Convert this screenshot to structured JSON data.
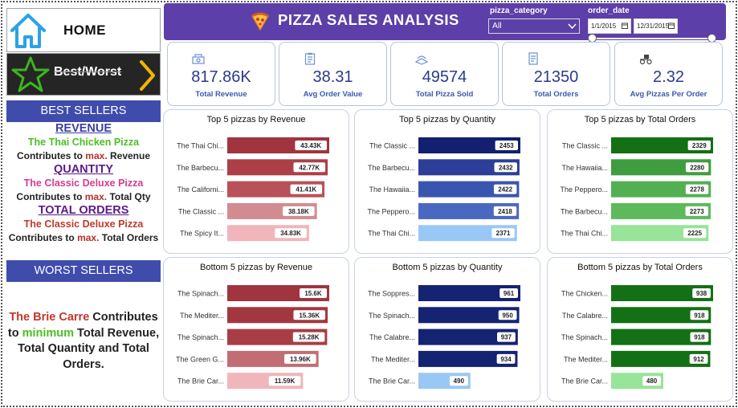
{
  "home": {
    "label": "HOME",
    "icon": "home-icon"
  },
  "nav": {
    "label": "Best/Worst",
    "icons": [
      "star-icon",
      "chevron-right-icon"
    ]
  },
  "best": {
    "heading": "BEST SELLERS",
    "revenue_hdr": "REVENUE",
    "revenue_pizza": "The Thai Chicken Pizza",
    "revenue_pre": "Contributes to ",
    "revenue_max": "max.",
    "revenue_post": " Revenue",
    "qty_hdr": "QUANTITY",
    "qty_pizza": "The Classic Deluxe Pizza",
    "qty_pre": "Contributes to ",
    "qty_max": "max.",
    "qty_post": " Total Qty",
    "orders_hdr": "TOTAL ORDERS",
    "orders_pizza": "The Classic Deluxe Pizza",
    "orders_pre": "Contributes to ",
    "orders_max": "max.",
    "orders_post": " Total Orders"
  },
  "worst": {
    "heading": "WORST SELLERS",
    "pizza": "The Brie Carre",
    "t1": " Contributes to ",
    "min": "minimum",
    "t2": " Total Revenue, Total Quantity and Total Orders."
  },
  "header": {
    "title": "PIZZA SALES ANALYSIS",
    "icon": "pizza-icon",
    "category_label": "pizza_category",
    "category_value": "All",
    "date_label": "order_date",
    "date_start": "1/1/2015",
    "date_end": "12/31/2015",
    "slider_start": 0,
    "slider_end": 1
  },
  "kpis": [
    {
      "value": "817.86K",
      "label": "Total Revenue",
      "icon": "money-icon"
    },
    {
      "value": "38.31",
      "label": "Avg Order Value",
      "icon": "clipboard-icon"
    },
    {
      "value": "49574",
      "label": "Total Pizza Sold",
      "icon": "pizza-box-icon"
    },
    {
      "value": "21350",
      "label": "Total Orders",
      "icon": "order-icon"
    },
    {
      "value": "2.32",
      "label": "Avg Pizzas Per Order",
      "icon": "delivery-icon"
    }
  ],
  "colors": {
    "header": "#5c3fa8",
    "section": "#3f4cab",
    "kpi_value": "#2b3a8c",
    "revenue": [
      "#a0353f",
      "#ac3f47",
      "#b85158",
      "#d28c91",
      "#f0b6bb"
    ],
    "quantity": [
      "#12206f",
      "#2c3e98",
      "#3a55b0",
      "#4b68c0",
      "#9ac8f6"
    ],
    "orders": [
      "#147014",
      "#3f9d3f",
      "#52b052",
      "#5cba5c",
      "#98e498"
    ],
    "bottom_revenue": [
      "#a0353f",
      "#a3373f",
      "#a83d45",
      "#c26d74",
      "#f0b6bb"
    ],
    "bottom_quantity": [
      "#152373",
      "#152373",
      "#152373",
      "#152373",
      "#9ac8f6"
    ],
    "bottom_orders": [
      "#147014",
      "#147014",
      "#147014",
      "#147014",
      "#98e498"
    ]
  },
  "chart_data": [
    {
      "type": "bar",
      "title": "Top 5 pizzas by Revenue",
      "categories": [
        "The Thai Chi...",
        "The Barbecu...",
        "The Californi...",
        "The Classic ...",
        "The Spicy It..."
      ],
      "values": [
        43434,
        42768,
        41410,
        38180,
        34831
      ],
      "labels": [
        "43.43K",
        "42.77K",
        "41.41K",
        "38.18K",
        "34.83K"
      ]
    },
    {
      "type": "bar",
      "title": "Top 5 pizzas by Quantity",
      "categories": [
        "The Classic ...",
        "The Barbecu...",
        "The Hawaiia...",
        "The Peppero...",
        "The Thai Chi..."
      ],
      "values": [
        2453,
        2432,
        2422,
        2418,
        2371
      ],
      "labels": [
        "2453",
        "2432",
        "2422",
        "2418",
        "2371"
      ]
    },
    {
      "type": "bar",
      "title": "Top 5 pizzas by Total Orders",
      "categories": [
        "The Classic ...",
        "The Hawaiia...",
        "The Peppero...",
        "The Barbecu...",
        "The Thai Chi..."
      ],
      "values": [
        2329,
        2280,
        2278,
        2273,
        2225
      ],
      "labels": [
        "2329",
        "2280",
        "2278",
        "2273",
        "2225"
      ]
    },
    {
      "type": "bar",
      "title": "Bottom 5 pizzas by Revenue",
      "categories": [
        "The Spinach...",
        "The Mediter...",
        "The Spinach...",
        "The Green G...",
        "The Brie Car..."
      ],
      "values": [
        15600,
        15360,
        15280,
        13960,
        11590
      ],
      "labels": [
        "15.6K",
        "15.36K",
        "15.28K",
        "13.96K",
        "11.59K"
      ]
    },
    {
      "type": "bar",
      "title": "Bottom 5 pizzas by Quantity",
      "categories": [
        "The Soppres...",
        "The Spinach...",
        "The Calabre...",
        "The Mediter...",
        "The Brie Car..."
      ],
      "values": [
        961,
        950,
        937,
        934,
        490
      ],
      "labels": [
        "961",
        "950",
        "937",
        "934",
        "490"
      ]
    },
    {
      "type": "bar",
      "title": "Bottom 5 pizzas by Total Orders",
      "categories": [
        "The Chicken...",
        "The Calabre...",
        "The Spinach...",
        "The Mediter...",
        "The Brie Car..."
      ],
      "values": [
        938,
        918,
        918,
        912,
        480
      ],
      "labels": [
        "938",
        "918",
        "918",
        "912",
        "480"
      ]
    }
  ]
}
